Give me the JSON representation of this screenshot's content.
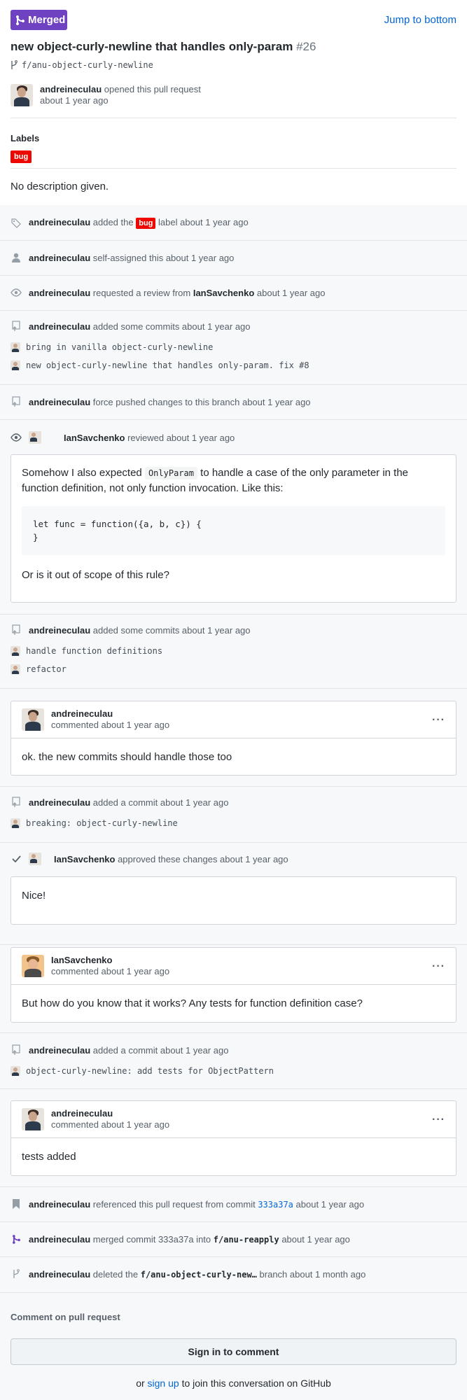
{
  "header": {
    "state_badge": "Merged",
    "jump_link": "Jump to bottom",
    "title": "new object-curly-newline that handles only-param",
    "number": "#26",
    "branch": "f/anu-object-curly-newline",
    "opener": {
      "user": "andreineculau",
      "action": "opened this pull request",
      "time": "about 1 year ago"
    },
    "labels_title": "Labels",
    "label": "bug",
    "label_color": "#ee0701",
    "description": "No description given."
  },
  "events": {
    "label_added": {
      "user": "andreineculau",
      "pre": "added the",
      "label": "bug",
      "post": "label about 1 year ago"
    },
    "self_assigned": {
      "user": "andreineculau",
      "text": "self-assigned this about 1 year ago"
    },
    "review_requested": {
      "user": "andreineculau",
      "text": "requested a review from",
      "reviewer": "IanSavchenko",
      "time": "about 1 year ago"
    },
    "commits1": {
      "user": "andreineculau",
      "text": "added some commits about 1 year ago",
      "commits": [
        "bring in vanilla object-curly-newline",
        "new object-curly-newline that handles only-param. fix #8"
      ]
    },
    "force_push": {
      "user": "andreineculau",
      "text": "force pushed changes to this branch about 1 year ago"
    },
    "review1": {
      "user": "IanSavchenko",
      "text": "reviewed about 1 year ago",
      "body_pre": "Somehow I also expected",
      "body_code": "OnlyParam",
      "body_post": "to handle a case of the only parameter in the function definition, not only function invocation. Like this:",
      "code_line1": "let func = function({a, b, c}) {",
      "code_line2": "}",
      "body_end": "Or is it out of scope of this rule?"
    },
    "commits2": {
      "user": "andreineculau",
      "text": "added some commits about 1 year ago",
      "commits": [
        "handle function definitions",
        "refactor"
      ]
    },
    "comment1": {
      "user": "andreineculau",
      "meta": "commented about 1 year ago",
      "body": "ok. the new commits should handle those too",
      "menu": "···"
    },
    "commit3": {
      "user": "andreineculau",
      "text": "added a commit about 1 year ago",
      "commits": [
        "breaking: object-curly-newline"
      ]
    },
    "review2": {
      "user": "IanSavchenko",
      "text": "approved these changes about 1 year ago",
      "body": "Nice!"
    },
    "comment2": {
      "user": "IanSavchenko",
      "meta": "commented about 1 year ago",
      "body": "But how do you know that it works? Any tests for function definition case?",
      "menu": "···"
    },
    "commit4": {
      "user": "andreineculau",
      "text": "added a commit about 1 year ago",
      "commits": [
        "object-curly-newline: add tests for ObjectPattern"
      ]
    },
    "comment3": {
      "user": "andreineculau",
      "meta": "commented about 1 year ago",
      "body": "tests added",
      "menu": "···"
    },
    "referenced": {
      "user": "andreineculau",
      "pre": "referenced this pull request from commit",
      "sha": "333a37a",
      "post": "about 1 year ago"
    },
    "merged": {
      "user": "andreineculau",
      "pre": "merged commit 333a37a into",
      "branch": "f/anu-reapply",
      "post": "about 1 year ago"
    },
    "deleted": {
      "user": "andreineculau",
      "pre": "deleted the",
      "branch": "f/anu-object-curly-new…",
      "post": "branch about 1 month ago"
    }
  },
  "footer": {
    "title": "Comment on pull request",
    "signin": "Sign in to comment",
    "or": "or",
    "signup": "sign up",
    "rest": "to join this conversation on GitHub"
  },
  "colors": {
    "merged": "#6f42c1",
    "link": "#0366d6",
    "timeline_bg": "#f6f8fa"
  }
}
